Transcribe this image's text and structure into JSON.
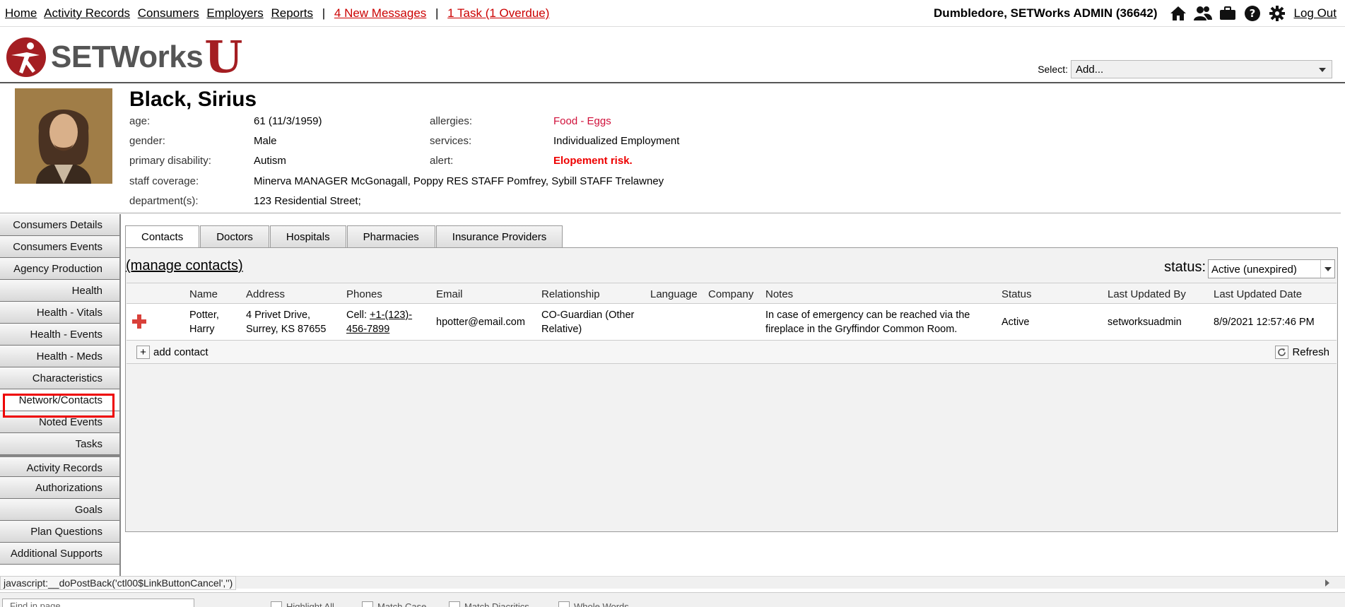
{
  "topnav": {
    "links": [
      "Home",
      "Activity Records",
      "Consumers",
      "Employers",
      "Reports"
    ],
    "messages": "4 New Messages",
    "tasks": "1 Task (1 Overdue)",
    "separator": "|",
    "user": "Dumbledore, SETWorks ADMIN  (36642)",
    "logout": "Log Out"
  },
  "brand": {
    "word": "SETWorks",
    "suffix": "U"
  },
  "select": {
    "label": "Select:",
    "value": "Add..."
  },
  "consumer": {
    "name": "Black, Sirius",
    "fields_left": [
      {
        "label": "age:",
        "value": "61 (11/3/1959)"
      },
      {
        "label": "gender:",
        "value": "Male"
      },
      {
        "label": "primary disability:",
        "value": "Autism"
      },
      {
        "label": "staff coverage:",
        "value": "Minerva MANAGER McGonagall, Poppy RES STAFF Pomfrey, Sybill STAFF Trelawney"
      },
      {
        "label": "department(s):",
        "value": "123 Residential Street;"
      }
    ],
    "fields_right": [
      {
        "label": "allergies:",
        "value": "Food - Eggs"
      },
      {
        "label": "services:",
        "value": "Individualized Employment"
      },
      {
        "label": "alert:",
        "value": "Elopement risk."
      }
    ]
  },
  "sidebar": {
    "items": [
      "Consumers Details",
      "Consumers Events",
      "Agency Production",
      "Health",
      "Health - Vitals",
      "Health - Events",
      "Health - Meds",
      "Characteristics",
      "Network/Contacts",
      "Noted Events",
      "Tasks",
      "Activity Records",
      "Authorizations",
      "Goals",
      "Plan Questions",
      "Additional Supports"
    ],
    "active": "Network/Contacts"
  },
  "tabs": [
    "Contacts",
    "Doctors",
    "Hospitals",
    "Pharmacies",
    "Insurance Providers"
  ],
  "panel": {
    "manage": "(manage contacts)",
    "status_label": "status:",
    "status_value": "Active (unexpired)"
  },
  "grid": {
    "columns": [
      "Name",
      "Address",
      "Phones",
      "Email",
      "Relationship",
      "Language",
      "Company",
      "Notes",
      "Status",
      "Last Updated By",
      "Last Updated Date"
    ],
    "row": {
      "name1": "Potter,",
      "name2": "Harry",
      "addr1": "4 Privet Drive,",
      "addr2": "Surrey, KS 87655",
      "phone_prefix": "Cell: ",
      "phone1": "+1-(123)-",
      "phone2": "456-7899",
      "email": "hpotter@email.com",
      "rel1": "CO-Guardian (Other",
      "rel2": "Relative)",
      "language": "",
      "company": "",
      "notes1": "In case of emergency can be reached via the",
      "notes2": "fireplace in the Gryffindor Common Room.",
      "status": "Active",
      "updated_by": "setworksuadmin",
      "updated_date": "8/9/2021 12:57:46 PM"
    },
    "add_label": "add contact",
    "refresh_label": "Refresh"
  },
  "statusbar": "javascript:__doPostBack('ctl00$LinkButtonCancel','')",
  "findbar": {
    "placeholder": "Find in page",
    "options": [
      "Highlight All",
      "Match Case",
      "Match Diacritics",
      "Whole Words"
    ]
  },
  "colors": {
    "brand_red": "#a41e22",
    "alert_red": "#e00000",
    "allergy_red": "#d0103a"
  },
  "icons": [
    "home-icon",
    "people-icon",
    "briefcase-icon",
    "help-icon",
    "gear-icon",
    "plus-icon",
    "refresh-icon",
    "red-cross-icon"
  ]
}
